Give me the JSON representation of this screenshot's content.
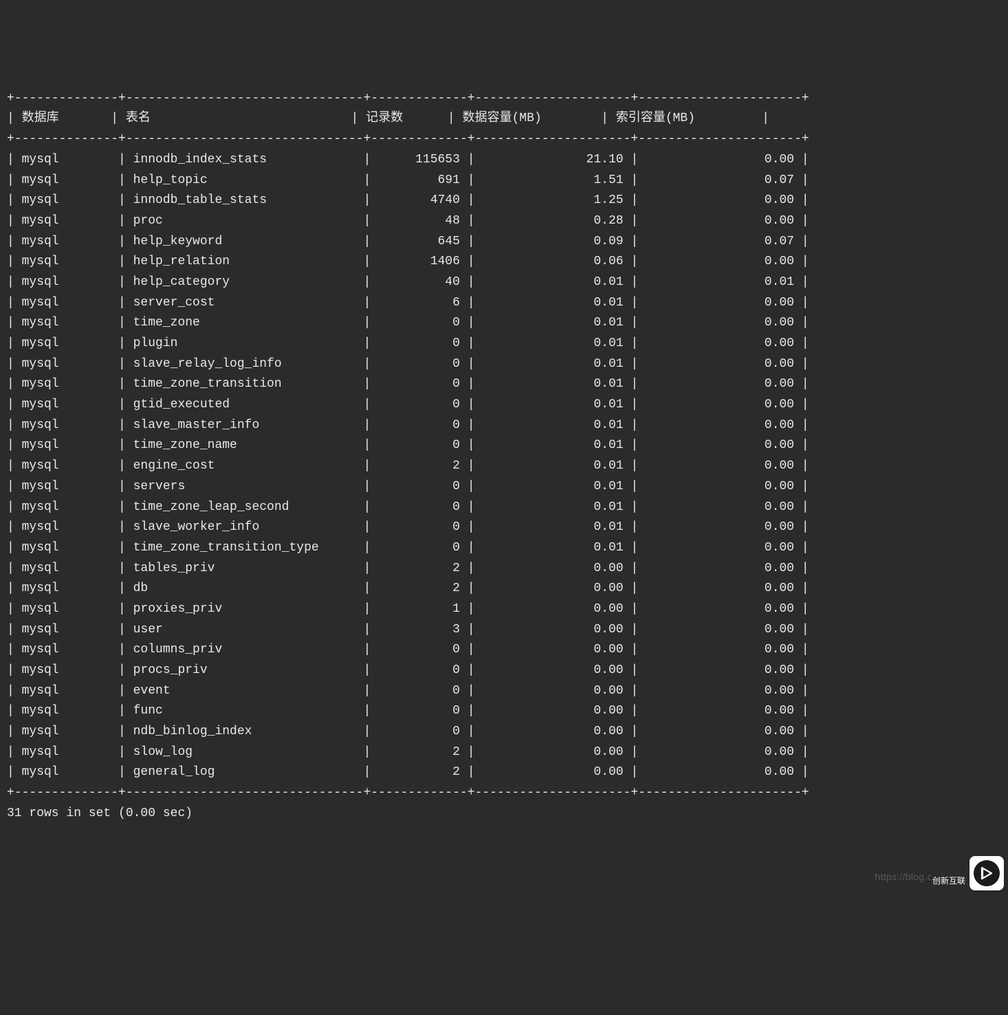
{
  "columns": [
    "数据库",
    "表名",
    "记录数",
    "数据容量(MB)",
    "索引容量(MB)"
  ],
  "rows": [
    {
      "db": "mysql",
      "table": "innodb_index_stats",
      "records": "115653",
      "data_mb": "21.10",
      "index_mb": "0.00"
    },
    {
      "db": "mysql",
      "table": "help_topic",
      "records": "691",
      "data_mb": "1.51",
      "index_mb": "0.07"
    },
    {
      "db": "mysql",
      "table": "innodb_table_stats",
      "records": "4740",
      "data_mb": "1.25",
      "index_mb": "0.00"
    },
    {
      "db": "mysql",
      "table": "proc",
      "records": "48",
      "data_mb": "0.28",
      "index_mb": "0.00"
    },
    {
      "db": "mysql",
      "table": "help_keyword",
      "records": "645",
      "data_mb": "0.09",
      "index_mb": "0.07"
    },
    {
      "db": "mysql",
      "table": "help_relation",
      "records": "1406",
      "data_mb": "0.06",
      "index_mb": "0.00"
    },
    {
      "db": "mysql",
      "table": "help_category",
      "records": "40",
      "data_mb": "0.01",
      "index_mb": "0.01"
    },
    {
      "db": "mysql",
      "table": "server_cost",
      "records": "6",
      "data_mb": "0.01",
      "index_mb": "0.00"
    },
    {
      "db": "mysql",
      "table": "time_zone",
      "records": "0",
      "data_mb": "0.01",
      "index_mb": "0.00"
    },
    {
      "db": "mysql",
      "table": "plugin",
      "records": "0",
      "data_mb": "0.01",
      "index_mb": "0.00"
    },
    {
      "db": "mysql",
      "table": "slave_relay_log_info",
      "records": "0",
      "data_mb": "0.01",
      "index_mb": "0.00"
    },
    {
      "db": "mysql",
      "table": "time_zone_transition",
      "records": "0",
      "data_mb": "0.01",
      "index_mb": "0.00"
    },
    {
      "db": "mysql",
      "table": "gtid_executed",
      "records": "0",
      "data_mb": "0.01",
      "index_mb": "0.00"
    },
    {
      "db": "mysql",
      "table": "slave_master_info",
      "records": "0",
      "data_mb": "0.01",
      "index_mb": "0.00"
    },
    {
      "db": "mysql",
      "table": "time_zone_name",
      "records": "0",
      "data_mb": "0.01",
      "index_mb": "0.00"
    },
    {
      "db": "mysql",
      "table": "engine_cost",
      "records": "2",
      "data_mb": "0.01",
      "index_mb": "0.00"
    },
    {
      "db": "mysql",
      "table": "servers",
      "records": "0",
      "data_mb": "0.01",
      "index_mb": "0.00"
    },
    {
      "db": "mysql",
      "table": "time_zone_leap_second",
      "records": "0",
      "data_mb": "0.01",
      "index_mb": "0.00"
    },
    {
      "db": "mysql",
      "table": "slave_worker_info",
      "records": "0",
      "data_mb": "0.01",
      "index_mb": "0.00"
    },
    {
      "db": "mysql",
      "table": "time_zone_transition_type",
      "records": "0",
      "data_mb": "0.01",
      "index_mb": "0.00"
    },
    {
      "db": "mysql",
      "table": "tables_priv",
      "records": "2",
      "data_mb": "0.00",
      "index_mb": "0.00"
    },
    {
      "db": "mysql",
      "table": "db",
      "records": "2",
      "data_mb": "0.00",
      "index_mb": "0.00"
    },
    {
      "db": "mysql",
      "table": "proxies_priv",
      "records": "1",
      "data_mb": "0.00",
      "index_mb": "0.00"
    },
    {
      "db": "mysql",
      "table": "user",
      "records": "3",
      "data_mb": "0.00",
      "index_mb": "0.00"
    },
    {
      "db": "mysql",
      "table": "columns_priv",
      "records": "0",
      "data_mb": "0.00",
      "index_mb": "0.00"
    },
    {
      "db": "mysql",
      "table": "procs_priv",
      "records": "0",
      "data_mb": "0.00",
      "index_mb": "0.00"
    },
    {
      "db": "mysql",
      "table": "event",
      "records": "0",
      "data_mb": "0.00",
      "index_mb": "0.00"
    },
    {
      "db": "mysql",
      "table": "func",
      "records": "0",
      "data_mb": "0.00",
      "index_mb": "0.00"
    },
    {
      "db": "mysql",
      "table": "ndb_binlog_index",
      "records": "0",
      "data_mb": "0.00",
      "index_mb": "0.00"
    },
    {
      "db": "mysql",
      "table": "slow_log",
      "records": "2",
      "data_mb": "0.00",
      "index_mb": "0.00"
    },
    {
      "db": "mysql",
      "table": "general_log",
      "records": "2",
      "data_mb": "0.00",
      "index_mb": "0.00"
    }
  ],
  "footer": "31 rows in set (0.00 sec)",
  "watermark_url": "https://blog.csdn.net",
  "watermark_brand": "创新互联",
  "col_widths": {
    "db": 12,
    "table": 30,
    "records": 11,
    "data_mb": 19,
    "index_mb": 20
  }
}
